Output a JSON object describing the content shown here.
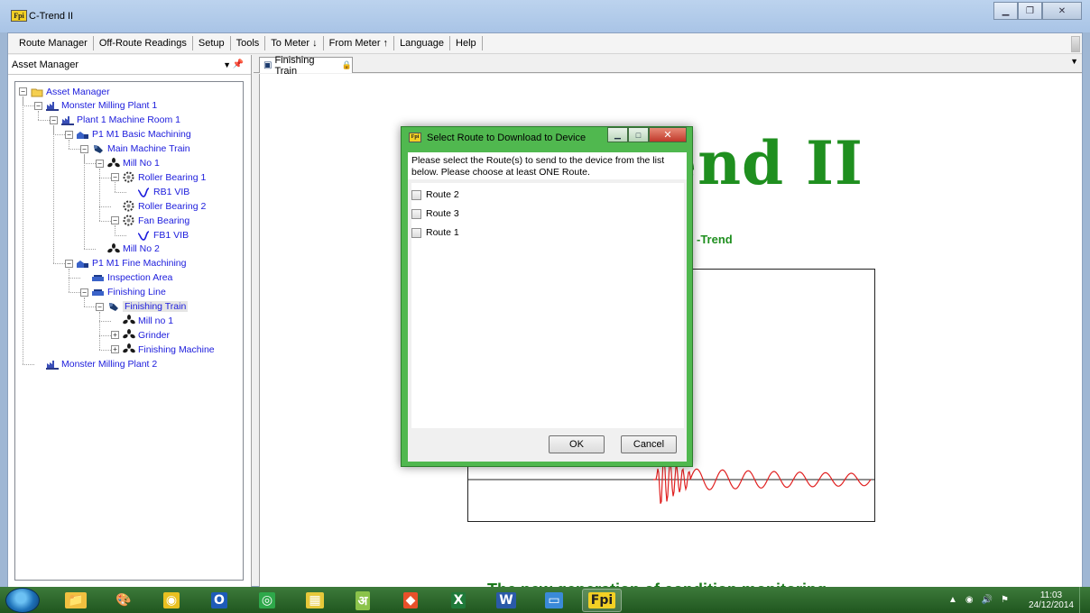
{
  "window": {
    "title": "C-Trend II",
    "app_icon_text": "Fpi"
  },
  "menu": [
    "Route Manager",
    "Off-Route Readings",
    "Setup",
    "Tools",
    "To Meter ↓",
    "From Meter ↑",
    "Language",
    "Help"
  ],
  "asset_pane": {
    "title": "Asset Manager"
  },
  "tree": [
    {
      "label": "Asset Manager",
      "icon": "folder-icon",
      "expander": "-"
    },
    {
      "label": "Monster Milling Plant 1",
      "icon": "plant-icon",
      "expander": "-"
    },
    {
      "label": "Plant 1 Machine Room 1",
      "icon": "plant-icon",
      "expander": "-"
    },
    {
      "label": "P1 M1 Basic Machining",
      "icon": "area-icon",
      "expander": "-"
    },
    {
      "label": "Main Machine Train",
      "icon": "train-icon",
      "expander": "-"
    },
    {
      "label": "Mill No 1",
      "icon": "machine-icon",
      "expander": "-"
    },
    {
      "label": "Roller Bearing 1",
      "icon": "bearing-icon",
      "expander": "-"
    },
    {
      "label": "RB1 VIB",
      "icon": "vibration-icon",
      "expander": ""
    },
    {
      "label": "Roller Bearing 2",
      "icon": "bearing-icon",
      "expander": ""
    },
    {
      "label": "Fan Bearing",
      "icon": "bearing-icon",
      "expander": "-"
    },
    {
      "label": "FB1 VIB",
      "icon": "vibration-icon",
      "expander": ""
    },
    {
      "label": "Mill No 2",
      "icon": "machine-icon",
      "expander": ""
    },
    {
      "label": "P1 M1 Fine Machining",
      "icon": "area-icon",
      "expander": "-"
    },
    {
      "label": "Inspection Area",
      "icon": "line-icon",
      "expander": ""
    },
    {
      "label": "Finishing Line",
      "icon": "line-icon",
      "expander": "-"
    },
    {
      "label": "Finishing Train",
      "icon": "train-icon",
      "expander": "-"
    },
    {
      "label": "Mill no 1",
      "icon": "machine-icon",
      "expander": ""
    },
    {
      "label": "Grinder",
      "icon": "machine-icon",
      "expander": "+"
    },
    {
      "label": "Finishing Machine",
      "icon": "machine-icon",
      "expander": "+"
    },
    {
      "label": "Monster Milling Plant 2",
      "icon": "plant-icon",
      "expander": ""
    }
  ],
  "doc_tab": {
    "label": "Finishing Train"
  },
  "splash": {
    "title": "C-Trend II",
    "subtitle": "-Trend",
    "tagline": "The new generation of condition monitoring"
  },
  "dialog": {
    "title": "Select Route to Download to Device",
    "message": "Please select the Route(s) to send to the device from the list below. Please choose at least ONE Route.",
    "routes": [
      "Route 2",
      "Route 3",
      "Route 1"
    ],
    "ok_label": "OK",
    "cancel_label": "Cancel"
  },
  "taskbar": {
    "apps": [
      "explorer-icon",
      "paint-icon",
      "chrome-icon",
      "outlook-icon",
      "spiral-icon",
      "calendar-icon",
      "hindi-icon",
      "git-icon",
      "excel-icon",
      "word-icon",
      "remote-icon",
      "ctrend-icon"
    ],
    "time": "11:03",
    "date": "24/12/2014"
  },
  "colors": {
    "brand_green": "#1f8f1f",
    "link_blue": "#1b1bdc",
    "dialog_frame": "#50b84f",
    "signal_red": "#e02020"
  }
}
